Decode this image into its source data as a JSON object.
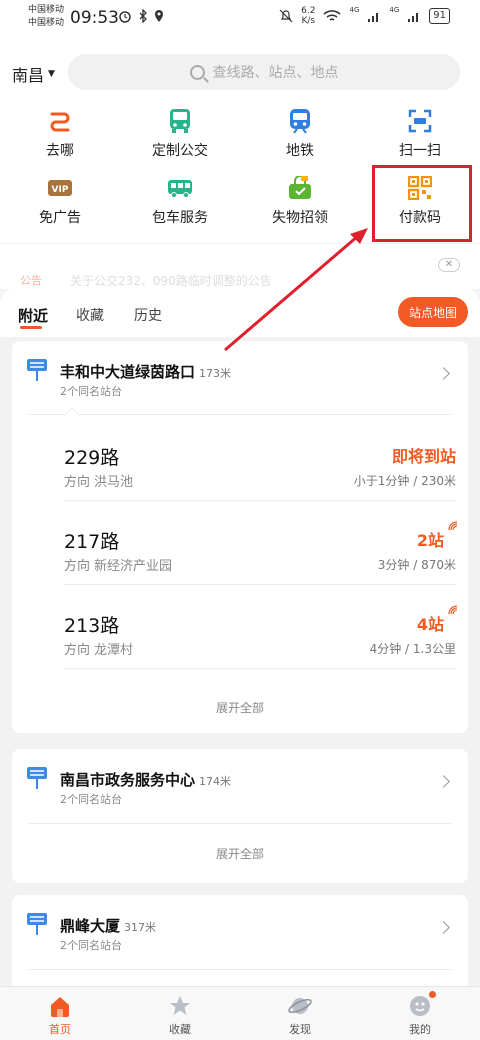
{
  "status_bar": {
    "carrier_1": "中国移动",
    "carrier_2": "中国移动",
    "time": "09:53",
    "network_speed_value": "6.2",
    "network_speed_unit": "K/s",
    "battery": "91",
    "signal_label_1": "4G",
    "signal_label_2": "4G"
  },
  "header": {
    "city": "南昌",
    "search_placeholder": "查线路、站点、地点"
  },
  "quick_actions": [
    {
      "label": "去哪",
      "icon": "route-icon"
    },
    {
      "label": "定制公交",
      "icon": "bus-icon"
    },
    {
      "label": "地铁",
      "icon": "metro-icon"
    },
    {
      "label": "扫一扫",
      "icon": "scan-icon"
    },
    {
      "label": "免广告",
      "icon": "vip-icon"
    },
    {
      "label": "包车服务",
      "icon": "charter-bus-icon"
    },
    {
      "label": "失物招领",
      "icon": "lost-found-icon"
    },
    {
      "label": "付款码",
      "icon": "qr-code-icon"
    }
  ],
  "notice": {
    "tag": "公告",
    "text": "关于公交232、090路临时调整的公告"
  },
  "tabs": {
    "nearby": "附近",
    "favorites": "收藏",
    "history": "历史",
    "map_button": "站点地图"
  },
  "stops": [
    {
      "name": "丰和中大道绿茵路口",
      "distance": "173米",
      "sub": "2个同名站台",
      "routes": [
        {
          "number": "229路",
          "dir_prefix": "方向",
          "direction": "洪马池",
          "status": "即将到站",
          "eta": "小于1分钟 / 230米"
        },
        {
          "number": "217路",
          "dir_prefix": "方向",
          "direction": "新经济产业园",
          "status": "2站",
          "eta": "3分钟 / 870米"
        },
        {
          "number": "213路",
          "dir_prefix": "方向",
          "direction": "龙潭村",
          "status": "4站",
          "eta": "4分钟 / 1.3公里"
        }
      ],
      "expand": "展开全部"
    },
    {
      "name": "南昌市政务服务中心",
      "distance": "174米",
      "sub": "2个同名站台",
      "expand": "展开全部"
    },
    {
      "name": "鼎峰大厦",
      "distance": "317米",
      "sub": "2个同名站台"
    }
  ],
  "bottom_nav": [
    {
      "label": "首页",
      "icon": "home-icon"
    },
    {
      "label": "收藏",
      "icon": "star-icon"
    },
    {
      "label": "发现",
      "icon": "planet-icon"
    },
    {
      "label": "我的",
      "icon": "profile-icon"
    }
  ],
  "colors": {
    "accent": "#f05a23",
    "highlight": "#e0202d"
  }
}
